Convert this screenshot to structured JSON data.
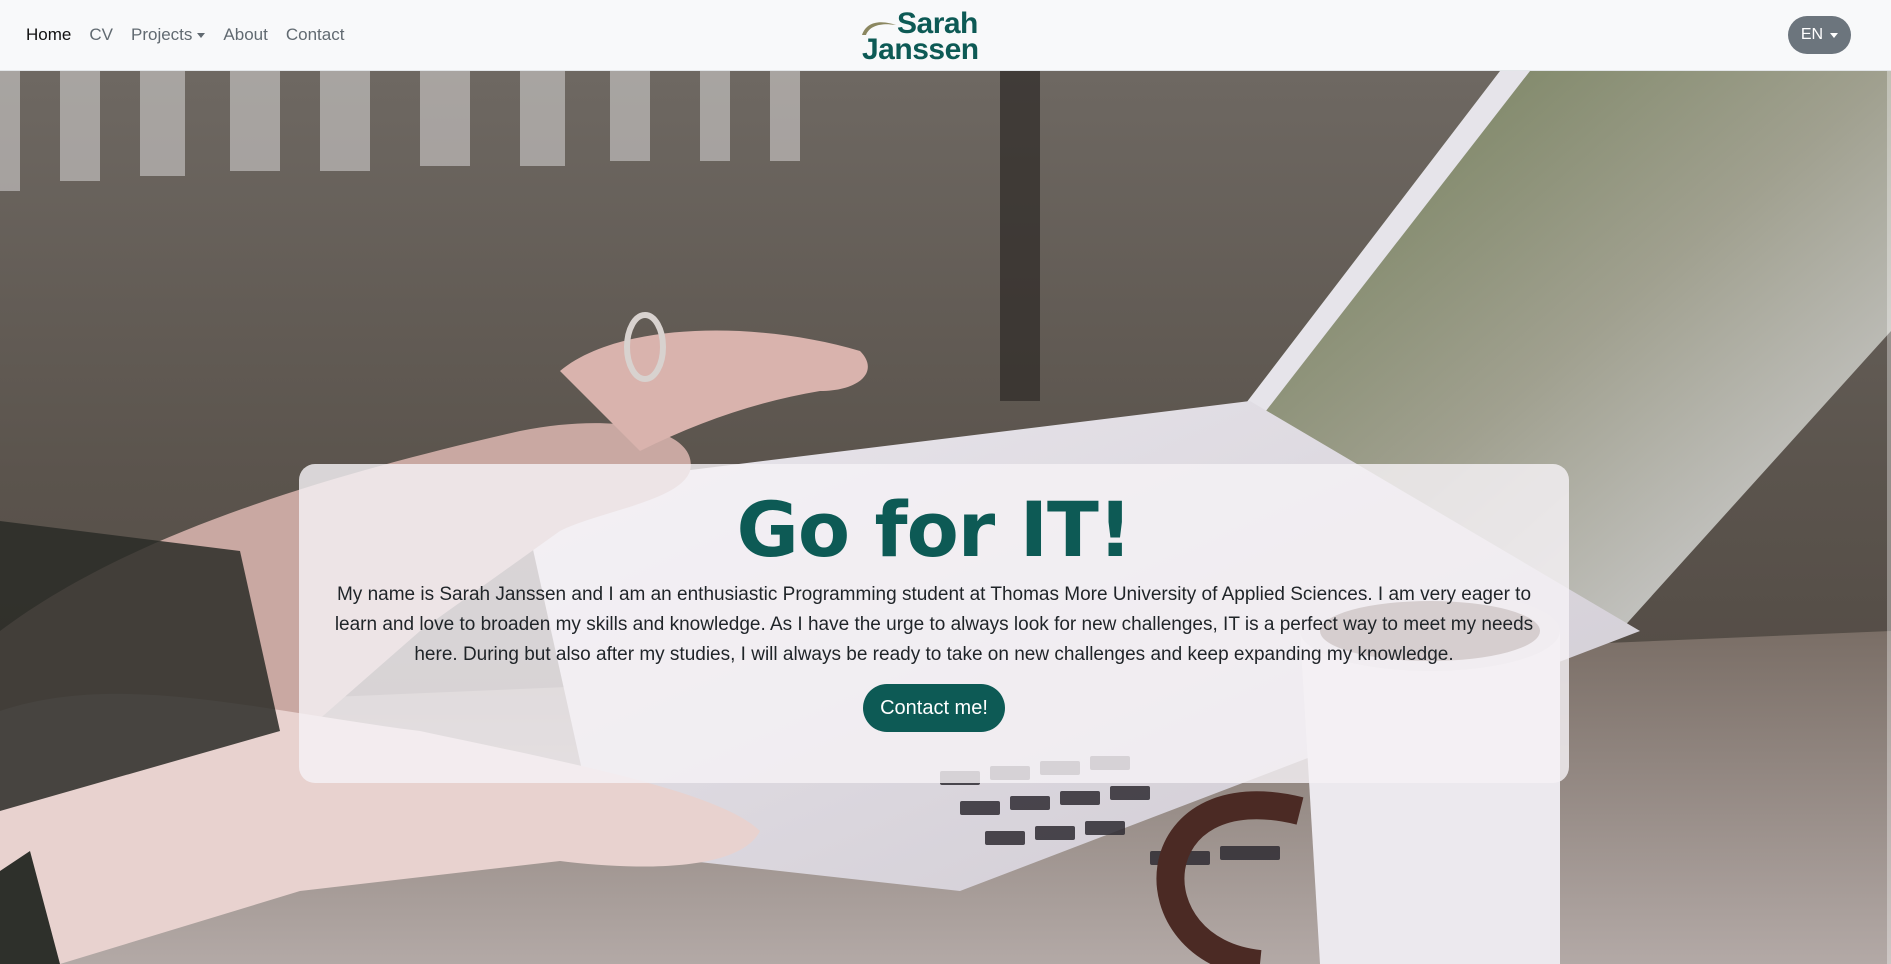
{
  "nav": {
    "links": [
      {
        "label": "Home"
      },
      {
        "label": "CV"
      },
      {
        "label": "Projects"
      },
      {
        "label": "About"
      },
      {
        "label": "Contact"
      }
    ]
  },
  "brand": {
    "line1": "Sarah",
    "line2": "Janssen"
  },
  "language": {
    "label": "EN"
  },
  "hero": {
    "title": "Go for IT!",
    "intro": "My name is Sarah Janssen and I am an enthusiastic Programming student at Thomas More University of Applied Sciences. I am very eager to learn and love to broaden my skills and knowledge. As I have the urge to always look for new challenges, IT is a perfect way to meet my needs here. During but also after my studies, I will always be ready to take on new challenges and keep expanding my knowledge.",
    "button_label": "Contact me!"
  },
  "colors": {
    "brand": "#0d5a55",
    "accent_swoosh": "#8b8760",
    "lang_button": "#6c757d",
    "navbar": "#f8f9fa"
  }
}
